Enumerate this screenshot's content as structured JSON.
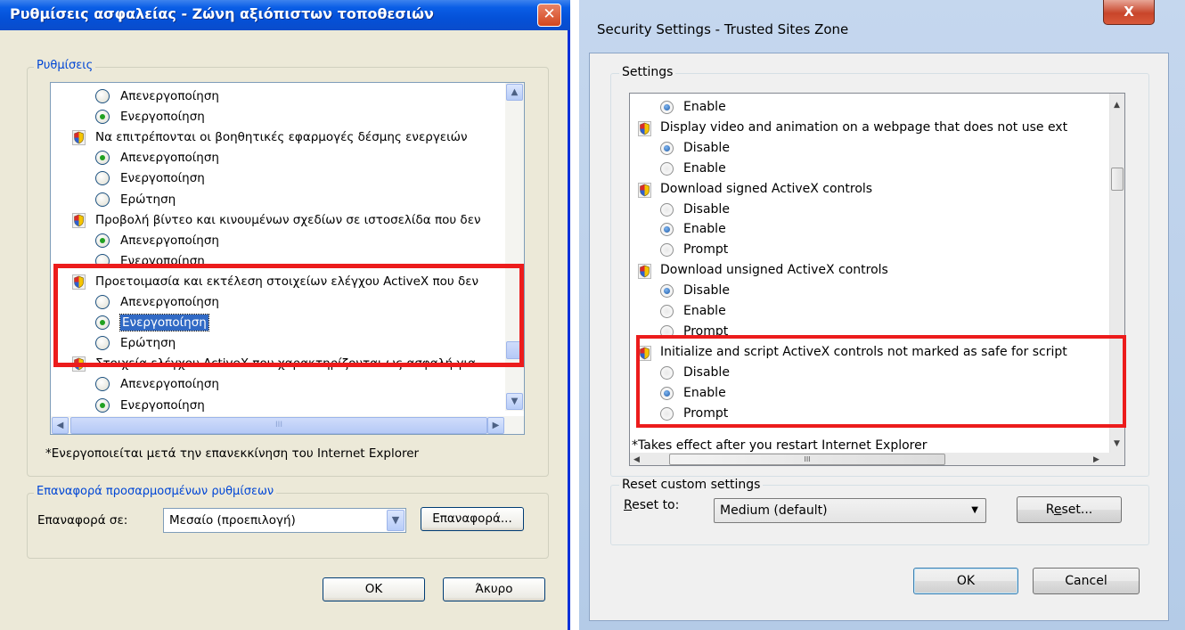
{
  "greek_dialog": {
    "title": "Ρυθμίσεις ασφαλείας - Ζώνη αξιόπιστων τοποθεσιών",
    "close_glyph": "✕",
    "settings_group_label": "Ρυθμίσεις",
    "items": [
      {
        "kind": "radio",
        "label": "Απενεργοποίηση",
        "selected": false
      },
      {
        "kind": "radio",
        "label": "Ενεργοποίηση",
        "selected": true
      },
      {
        "kind": "header",
        "label": "Να επιτρέπονται οι βοηθητικές εφαρμογές δέσμης ενεργειών"
      },
      {
        "kind": "radio",
        "label": "Απενεργοποίηση",
        "selected": true
      },
      {
        "kind": "radio",
        "label": "Ενεργοποίηση",
        "selected": false
      },
      {
        "kind": "radio",
        "label": "Ερώτηση",
        "selected": false
      },
      {
        "kind": "header",
        "label": "Προβολή βίντεο και κινουμένων σχεδίων σε ιστοσελίδα που δεν"
      },
      {
        "kind": "radio",
        "label": "Απενεργοποίηση",
        "selected": true
      },
      {
        "kind": "radio",
        "label": "Ενεργοποίηση",
        "selected": false
      },
      {
        "kind": "header",
        "label": "Προετοιμασία και εκτέλεση στοιχείων ελέγχου ActiveX που δεν"
      },
      {
        "kind": "radio",
        "label": "Απενεργοποίηση",
        "selected": false
      },
      {
        "kind": "radio",
        "label": "Ενεργοποίηση",
        "selected": true,
        "focused": true
      },
      {
        "kind": "radio",
        "label": "Ερώτηση",
        "selected": false
      },
      {
        "kind": "header",
        "label": "Στοιχεία ελέγχου ActiveX που χαρακτηρίζονται ως ασφαλή για"
      },
      {
        "kind": "radio",
        "label": "Απενεργοποίηση",
        "selected": false
      },
      {
        "kind": "radio",
        "label": "Ενεργοποίηση",
        "selected": true
      }
    ],
    "restart_note": "*Ενεργοποιείται μετά την επανεκκίνηση του Internet Explorer",
    "reset_group_label": "Επαναφορά προσαρμοσμένων ρυθμίσεων",
    "reset_to_label": "Επαναφορά σε:",
    "reset_to_value": "Μεσαίο (προεπιλογή)",
    "reset_button": "Επαναφορά...",
    "ok_button": "OK",
    "cancel_button": "Άκυρο",
    "hscroll_grip": "III"
  },
  "english_dialog": {
    "title": "Security Settings - Trusted Sites Zone",
    "close_glyph": "X",
    "settings_group_label": "Settings",
    "items": [
      {
        "kind": "radio",
        "label": "Enable",
        "selected": true
      },
      {
        "kind": "header",
        "label": "Display video and animation on a webpage that does not use ext"
      },
      {
        "kind": "radio",
        "label": "Disable",
        "selected": true
      },
      {
        "kind": "radio",
        "label": "Enable",
        "selected": false
      },
      {
        "kind": "header",
        "label": "Download signed ActiveX controls"
      },
      {
        "kind": "radio",
        "label": "Disable",
        "selected": false
      },
      {
        "kind": "radio",
        "label": "Enable",
        "selected": true
      },
      {
        "kind": "radio",
        "label": "Prompt",
        "selected": false
      },
      {
        "kind": "header",
        "label": "Download unsigned ActiveX controls"
      },
      {
        "kind": "radio",
        "label": "Disable",
        "selected": true
      },
      {
        "kind": "radio",
        "label": "Enable",
        "selected": false
      },
      {
        "kind": "radio",
        "label": "Prompt",
        "selected": false
      },
      {
        "kind": "header",
        "label": "Initialize and script ActiveX controls not marked as safe for script"
      },
      {
        "kind": "radio",
        "label": "Disable",
        "selected": false
      },
      {
        "kind": "radio",
        "label": "Enable",
        "selected": true
      },
      {
        "kind": "radio",
        "label": "Prompt",
        "selected": false
      }
    ],
    "restart_note": "*Takes effect after you restart Internet Explorer",
    "reset_group_label": "Reset custom settings",
    "reset_to_label_prefix": "",
    "reset_to_label_ul": "R",
    "reset_to_label_rest": "eset to:",
    "reset_to_value": "Medium (default)",
    "reset_btn_pre": "R",
    "reset_btn_ul": "e",
    "reset_btn_post": "set...",
    "ok_button": "OK",
    "cancel_button": "Cancel",
    "hscroll_grip": "III"
  },
  "colors": {
    "highlight": "#ec1c1c",
    "xp_title": "#0451d8",
    "xp_face": "#ece9d8",
    "w7_face": "#f0f0f0"
  }
}
